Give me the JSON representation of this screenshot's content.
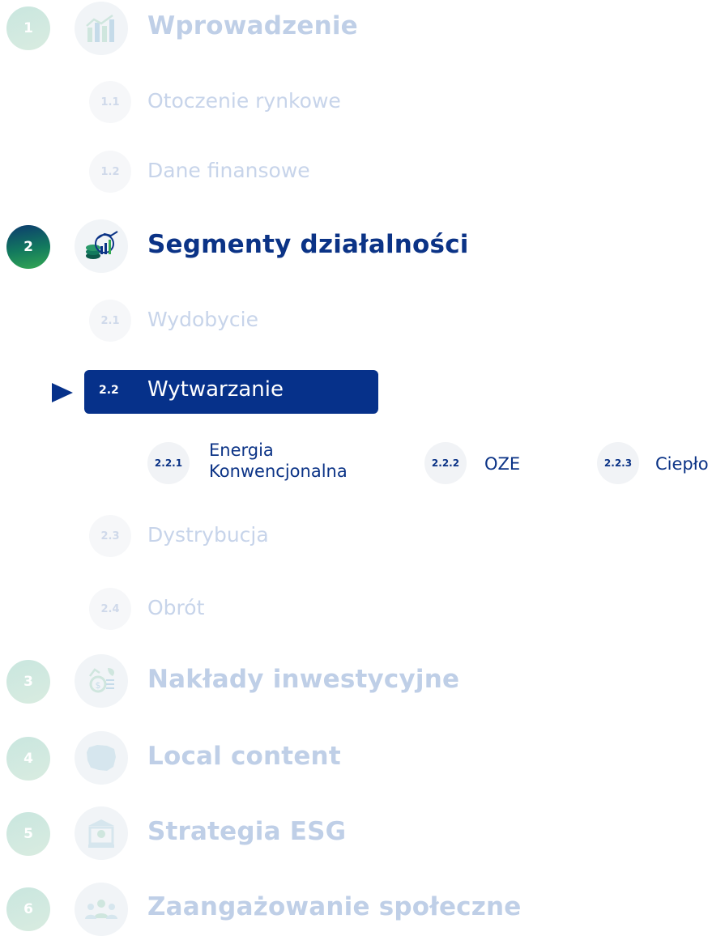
{
  "sections": [
    {
      "number": "1",
      "title": "Wprowadzenie",
      "icon": "bar-growth-icon",
      "state": "faded"
    },
    {
      "number": "2",
      "title": "Segmenty działalności",
      "icon": "coins-growth-icon",
      "state": "active"
    },
    {
      "number": "3",
      "title": "Nakłady inwestycyjne",
      "icon": "investment-icon",
      "state": "faded"
    },
    {
      "number": "4",
      "title": "Local content",
      "icon": "poland-map-icon",
      "state": "faded"
    },
    {
      "number": "5",
      "title": "Strategia ESG",
      "icon": "esg-building-icon",
      "state": "faded"
    },
    {
      "number": "6",
      "title": "Zaangażowanie społeczne",
      "icon": "people-icon",
      "state": "faded"
    }
  ],
  "subsections": {
    "s1_1": {
      "number": "1.1",
      "label": "Otoczenie rynkowe"
    },
    "s1_2": {
      "number": "1.2",
      "label": "Dane finansowe"
    },
    "s2_1": {
      "number": "2.1",
      "label": "Wydobycie"
    },
    "s2_2": {
      "number": "2.2",
      "label": "Wytwarzanie",
      "active": true
    },
    "s2_3": {
      "number": "2.3",
      "label": "Dystrybucja"
    },
    "s2_4": {
      "number": "2.4",
      "label": "Obrót"
    }
  },
  "subsubsections": [
    {
      "number": "2.2.1",
      "label_line1": "Energia",
      "label_line2": "Konwencjonalna"
    },
    {
      "number": "2.2.2",
      "label": "OZE"
    },
    {
      "number": "2.2.3",
      "label": "Ciepło"
    }
  ],
  "colors": {
    "active_navy": "#0b3386",
    "active_bar": "#06318a",
    "faded_title": "#bfcfe7",
    "faded_sub": "#c7d4ea",
    "circle_faded_green": "#c9e6df"
  }
}
